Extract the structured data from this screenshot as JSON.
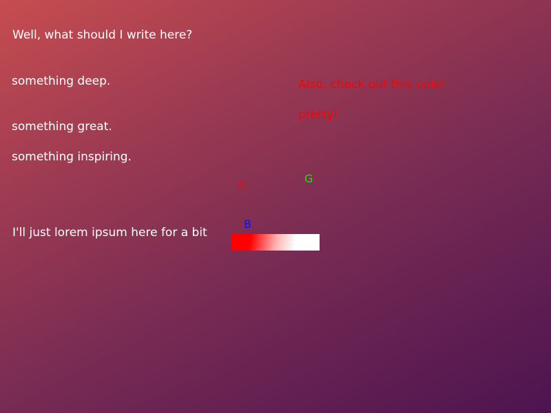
{
  "content": {
    "headline": "Well, what should I write here?",
    "lines": [
      "something deep.",
      "something great.",
      "something inspiring."
    ],
    "lorem_line": "I'll just lorem ipsum here for a bit"
  },
  "color_panel": {
    "note": "Also, check out this color",
    "exclaim": "pretty!",
    "channels": {
      "r": "R",
      "g": "G",
      "b": "B"
    },
    "swatch_colors": {
      "start": "#ff0000",
      "end": "#ffffff"
    }
  },
  "theme": {
    "background_start": "#c64d50",
    "background_end": "#4d1450",
    "text_color": "#ffffff",
    "accent_red": "#ff0000"
  }
}
